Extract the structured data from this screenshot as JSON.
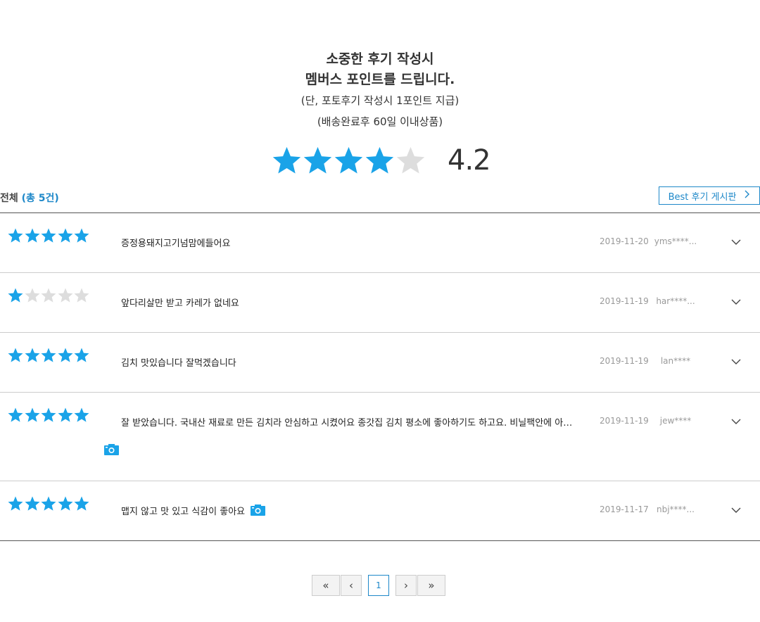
{
  "promo": {
    "line1": "소중한 후기 작성시",
    "line2": "멤버스 포인트를 드립니다.",
    "line3": "(단, 포토후기 작성시 1포인트 지급)",
    "line4": "(배송완료후 60일 이내상품)"
  },
  "rating": {
    "average": "4.2",
    "filled_stars": 4,
    "max_stars": 5
  },
  "summary": {
    "label": "전체",
    "count_label": "(총 5건)"
  },
  "best_button": {
    "label": "Best 후기 게시판",
    "icon": "chevron-right-icon"
  },
  "colors": {
    "accent": "#1e88c9",
    "star_filled": "#1aa3e8",
    "star_empty": "#dddddd",
    "date": "#999999"
  },
  "reviews": [
    {
      "stars": 5,
      "title": "증정용돼지고기넘맘에들어요",
      "date": "2019-11-20",
      "user": "yms****...",
      "photo": false
    },
    {
      "stars": 1,
      "title": "앞다리살만 받고 카레가 없네요",
      "date": "2019-11-19",
      "user": "har****...",
      "photo": false
    },
    {
      "stars": 5,
      "title": "김치 맛있습니다 잘먹겠습니다",
      "date": "2019-11-19",
      "user": "lan****",
      "photo": false
    },
    {
      "stars": 5,
      "title": "잘 받았습니다. 국내산 재료로 만든 김치라 안심하고 시켰어요 종갓집 김치 평소에 좋아하기도 하고요. 비닐팩안에 아이스팩 들어있어서 시원하게 잘 도착했어요",
      "date": "2019-11-19",
      "user": "jew****",
      "photo": true,
      "photo_below": true
    },
    {
      "stars": 5,
      "title": "맵지 않고 맛 있고 식감이 좋아요",
      "date": "2019-11-17",
      "user": "nbj****...",
      "photo": true,
      "photo_below": false
    }
  ],
  "pagination": {
    "first": "«",
    "prev": "‹",
    "current": "1",
    "next": "›",
    "last": "»"
  }
}
